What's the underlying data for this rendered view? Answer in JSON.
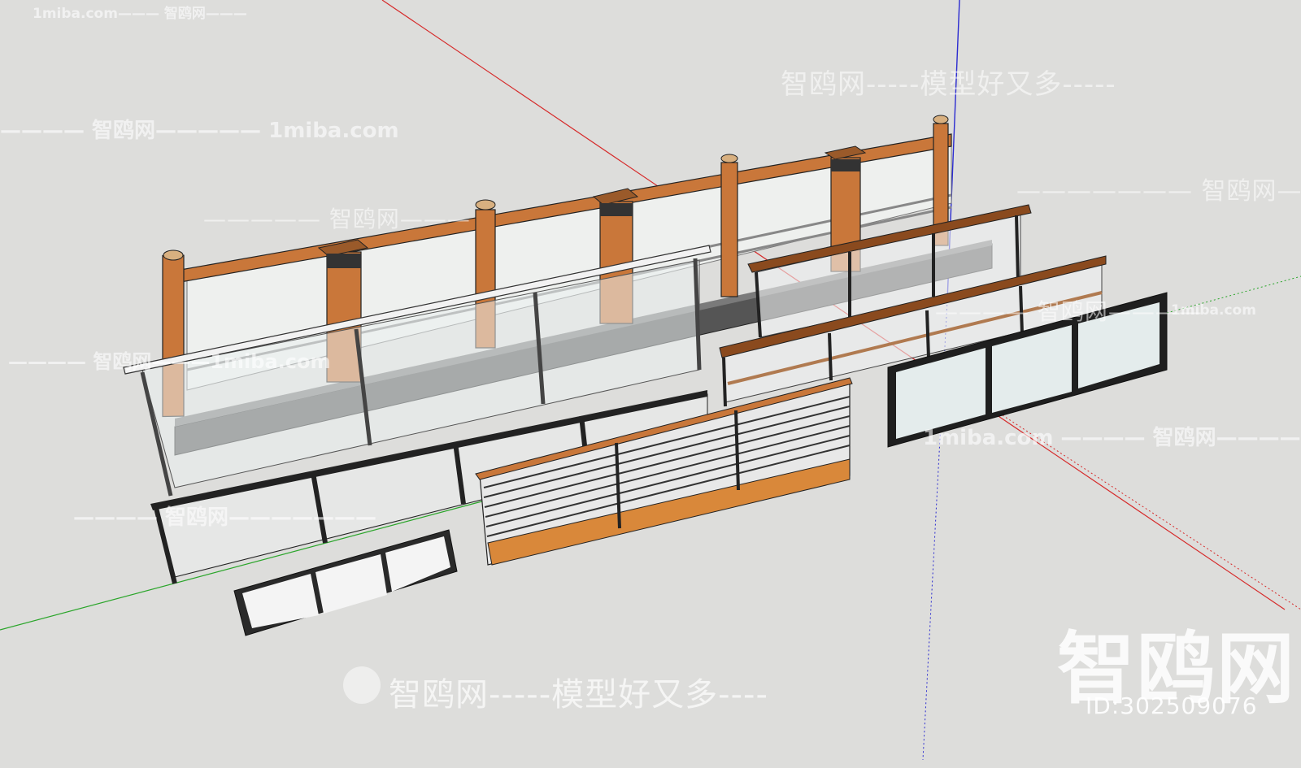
{
  "watermarks": {
    "top_left": "1miba.com——— 智鸥网———",
    "top_mid": "智鸥网-----模型好又多-----",
    "left_1": "———— 智鸥网————— 1miba.com",
    "mid_1": "————— 智鸥网———",
    "right_1": "——————— 智鸥网—",
    "left_2": "———— 智鸥网———1miba.com",
    "center_1": "———— 智鸥网————",
    "right_2": "1miba.com",
    "right_3": "1miba.com ———— 智鸥网————",
    "left_3": "———— 智鸥网———————",
    "bottom": "智鸥网-----模型好又多----",
    "big": "智鸥网",
    "id": "ID:302509076"
  },
  "axes": {
    "red": "#d62a2a",
    "green": "#2aa52a",
    "blue": "#2b2bd0"
  },
  "colors": {
    "background": "#dddddb",
    "wood": "#c9773a",
    "wood_dark": "#8a4a1e",
    "metal": "#2a2a2a",
    "glass": "#e8ecec",
    "shadow": "#5c5c5c"
  }
}
